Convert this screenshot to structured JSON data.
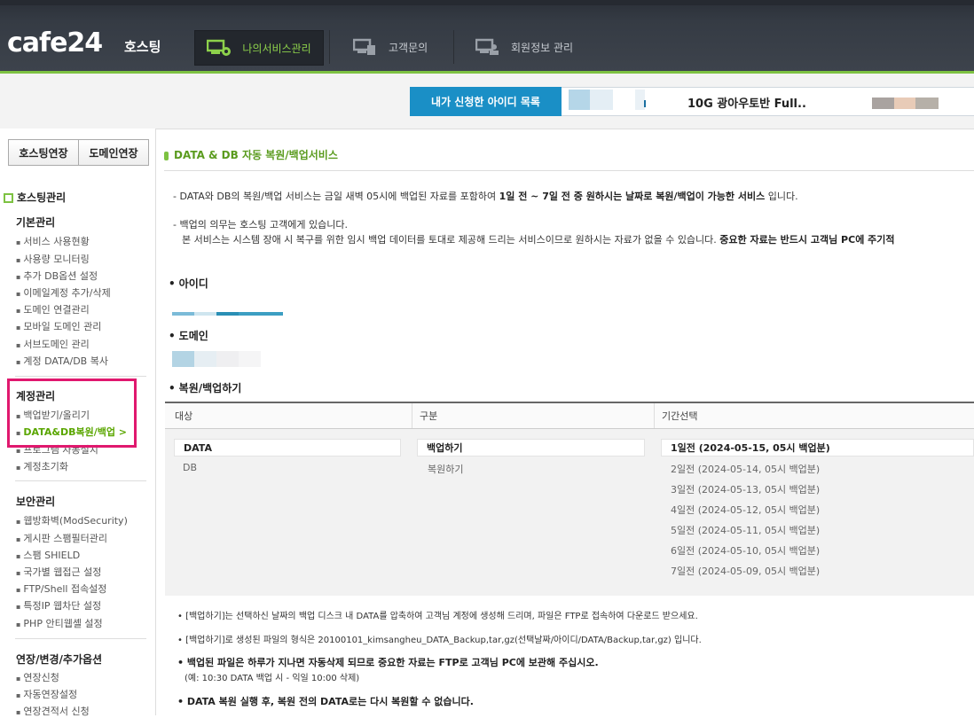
{
  "header": {
    "logo": "cafe24",
    "logo_sub": "호스팅",
    "nav": [
      {
        "label": "나의서비스관리",
        "icon": "service-gear-icon",
        "active": true
      },
      {
        "label": "고객문의",
        "icon": "support-icon",
        "active": false
      },
      {
        "label": "회원정보 관리",
        "icon": "member-icon",
        "active": false
      }
    ]
  },
  "id_list": {
    "label": "내가 신청한 아이디 목록",
    "selected_text": "10G 광아우토반 Full.."
  },
  "sidebar": {
    "buttons": [
      "호스팅연장",
      "도메인연장"
    ],
    "section_title": "호스팅관리",
    "groups": [
      {
        "title": "기본관리",
        "items": [
          "서비스 사용현황",
          "사용량 모니터링",
          "추가 DB옵션 설정",
          "이메일계정 추가/삭제",
          "도메인 연결관리",
          "모바일 도메인 관리",
          "서브도메인 관리",
          "계정 DATA/DB 복사"
        ]
      },
      {
        "title": "계정관리",
        "items": [
          "백업받기/올리기",
          "DATA&DB복원/백업 >",
          "프로그램 자동설치",
          "계정초기화"
        ]
      },
      {
        "title": "보안관리",
        "items": [
          "웹방화벽(ModSecurity)",
          "게시판 스팸필터관리",
          "스팸 SHIELD",
          "국가별 웹접근 설정",
          "FTP/Shell 접속설정",
          "특정IP 웹차단 설정",
          "PHP 안티웹셸 설정"
        ]
      },
      {
        "title": "연장/변경/추가옵션",
        "items": [
          "연장신청",
          "자동연장설정",
          "연장견적서 신청"
        ]
      }
    ]
  },
  "page": {
    "title": "DATA & DB 자동 복원/백업서비스",
    "desc1_a": "- DATA와 DB의 복원/백업 서비스는 금일 새벽 05시에 백업된 자료를 포함하여 ",
    "desc1_b": "1일 전 ~ 7일 전 중 원하시는 날짜로 복원/백업이 가능한 서비스",
    "desc1_c": " 입니다.",
    "desc2": "- 백업의 의무는 호스팅 고객에게 있습니다.",
    "desc3_a": "본 서비스는 시스템 장애 시 복구를 위한 임시 백업 데이터를 토대로 제공해 드리는 서비스이므로 원하시는 자료가 없을 수 있습니다. ",
    "desc3_b": "중요한 자료는 반드시 고객님 PC에 주기적",
    "sec_id": "아이디",
    "sec_domain": "도메인",
    "sec_restore": "복원/백업하기",
    "table": {
      "headers": [
        "대상",
        "구분",
        "기간선택"
      ],
      "targets": [
        "DATA",
        "DB"
      ],
      "actions": [
        "백업하기",
        "복원하기"
      ],
      "periods": [
        "1일전 (2024-05-15, 05시 백업분)",
        "2일전 (2024-05-14, 05시 백업분)",
        "3일전 (2024-05-13, 05시 백업분)",
        "4일전 (2024-05-12, 05시 백업분)",
        "5일전 (2024-05-11, 05시 백업분)",
        "6일전 (2024-05-10, 05시 백업분)",
        "7일전 (2024-05-09, 05시 백업분)"
      ]
    },
    "notes": [
      "• [백업하기]는 선택하신 날짜의 백업 디스크 내 DATA를 압축하여 고객님 계정에 생성해 드리며, 파일은 FTP로 접속하여 다운로드 받으세요.",
      "• [백업하기]로 생성된 파일의 형식은 20100101_kimsangheu_DATA_Backup,tar,gz(선택날짜/아이디/DATA/Backup,tar,gz) 입니다.",
      "• 백업된 파일은 하루가 지나면 자동삭제 되므로 중요한 자료는 FTP로 고객님 PC에 보관해 주십시오.",
      "(예: 10:30 DATA 백업 시 - 익일 10:00 삭제)",
      "• DATA 복원 실행 후, 복원 전의 DATA로는 다시 복원할 수 없습니다."
    ]
  },
  "colors": {
    "accent_green": "#7dc242",
    "accent_blue": "#1a8fc6",
    "highlight_pink": "#e0186e"
  }
}
